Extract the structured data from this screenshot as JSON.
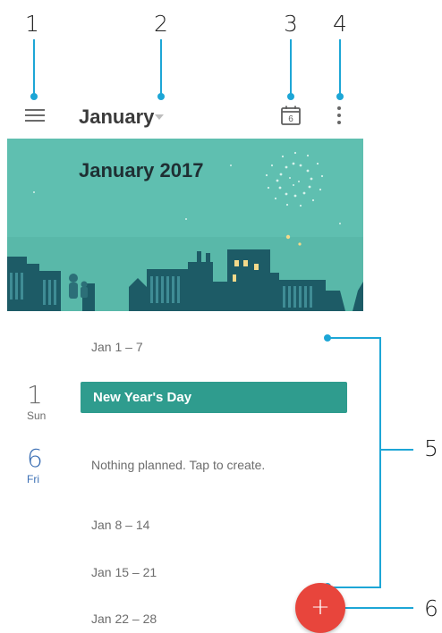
{
  "callouts": [
    "1",
    "2",
    "3",
    "4",
    "5",
    "6"
  ],
  "header": {
    "month": "January",
    "today_day": "6",
    "icons": [
      "menu-icon",
      "dropdown-arrow-icon",
      "today-calendar-icon",
      "overflow-menu-icon"
    ]
  },
  "banner": {
    "title": "January 2017"
  },
  "schedule": {
    "week1": "Jan 1 – 7",
    "week2": "Jan 8 – 14",
    "week3": "Jan 15 – 21",
    "week4": "Jan 22 – 28",
    "days": [
      {
        "num": "1",
        "weekday": "Sun",
        "color": "#6d6d6d"
      },
      {
        "num": "6",
        "weekday": "Fri",
        "color": "#3b6fb4"
      }
    ],
    "event": "New Year's Day",
    "empty": "Nothing planned. Tap to create."
  },
  "colors": {
    "accent": "#1da6d6",
    "event": "#2f9c8e",
    "fab": "#e8453c",
    "today": "#3b6fb4"
  },
  "fab": {
    "label": "+"
  }
}
